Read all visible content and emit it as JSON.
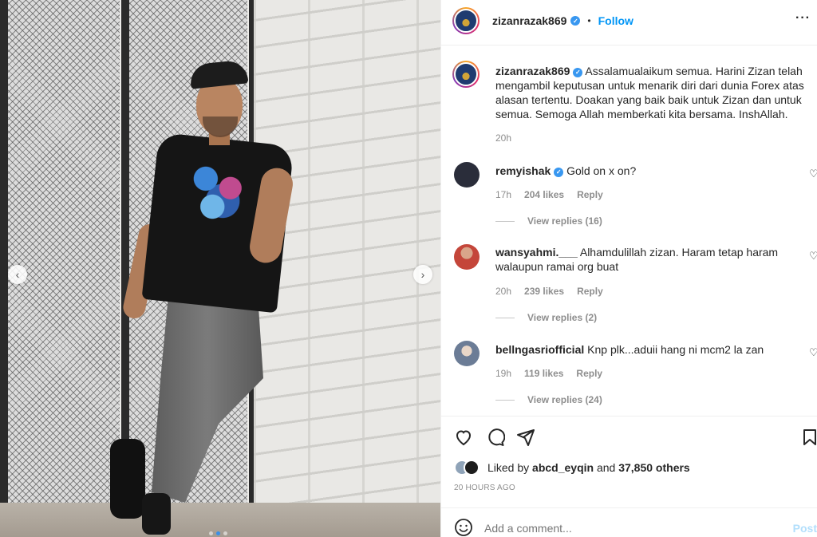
{
  "header": {
    "username": "zizanrazak869",
    "separator": "•",
    "follow_label": "Follow",
    "more_label": "···"
  },
  "caption": {
    "username": "zizanrazak869",
    "text": "Assalamualaikum semua. Harini Zizan telah mengambil keputusan untuk menarik diri dari dunia Forex atas alasan tertentu. Doakan yang baik baik untuk Zizan dan untuk semua. Semoga Allah memberkati kita bersama. InshAllah.",
    "time": "20h"
  },
  "comments": [
    {
      "username": "remyishak",
      "verified": true,
      "text": "Gold on x on?",
      "time": "17h",
      "likes": "204 likes",
      "reply_label": "Reply",
      "view_replies": "View replies (16)",
      "avatar_color": "#2a2d3a"
    },
    {
      "username": "wansyahmi.___",
      "verified": false,
      "text": "Alhamdulillah zizan. Haram tetap haram walaupun ramai org buat",
      "time": "20h",
      "likes": "239 likes",
      "reply_label": "Reply",
      "view_replies": "View replies (2)",
      "avatar_color": "#c4463a"
    },
    {
      "username": "bellngasriofficial",
      "verified": false,
      "text": "Knp plk...aduii hang ni mcm2 la zan",
      "time": "19h",
      "likes": "119 likes",
      "reply_label": "Reply",
      "view_replies": "View replies (24)",
      "avatar_color": "#6b7c96"
    }
  ],
  "actions": {
    "like_icon": "heart-icon",
    "comment_icon": "comment-icon",
    "share_icon": "share-icon",
    "save_icon": "bookmark-icon"
  },
  "likes_summary": {
    "prefix": "Liked by",
    "user": "abcd_eyqin",
    "middle": "and",
    "others": "37,850 others"
  },
  "timestamp": "20 HOURS AGO",
  "comment_box": {
    "placeholder": "Add a comment...",
    "post_label": "Post"
  },
  "carousel": {
    "prev_icon": "chevron-left-icon",
    "next_icon": "chevron-right-icon",
    "slide_count": 3,
    "active_slide": 2
  },
  "colors": {
    "accent": "#0095f6",
    "verified": "#3897f0",
    "muted": "#8e8e8e"
  }
}
